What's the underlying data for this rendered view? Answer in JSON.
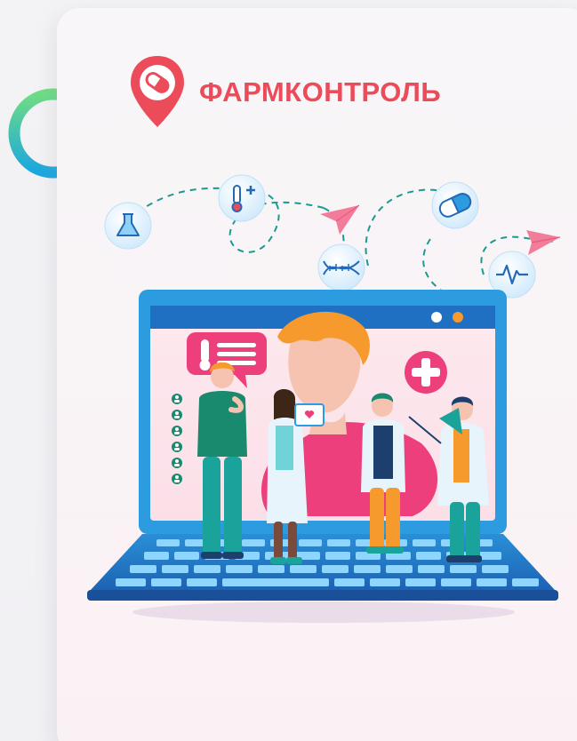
{
  "brand": {
    "name": "ФАРМКОНТРОЛЬ"
  },
  "colors": {
    "accent": "#ec4b5a",
    "screen_blue": "#2d9be0",
    "teal": "#1aa39a",
    "pink": "#ec3f7c",
    "orange": "#f79a2e"
  },
  "icons": [
    "flask-icon",
    "thermometer-icon",
    "dna-icon",
    "pill-icon",
    "heartbeat-icon",
    "paper-plane-icon",
    "plus-icon",
    "user-icon"
  ]
}
